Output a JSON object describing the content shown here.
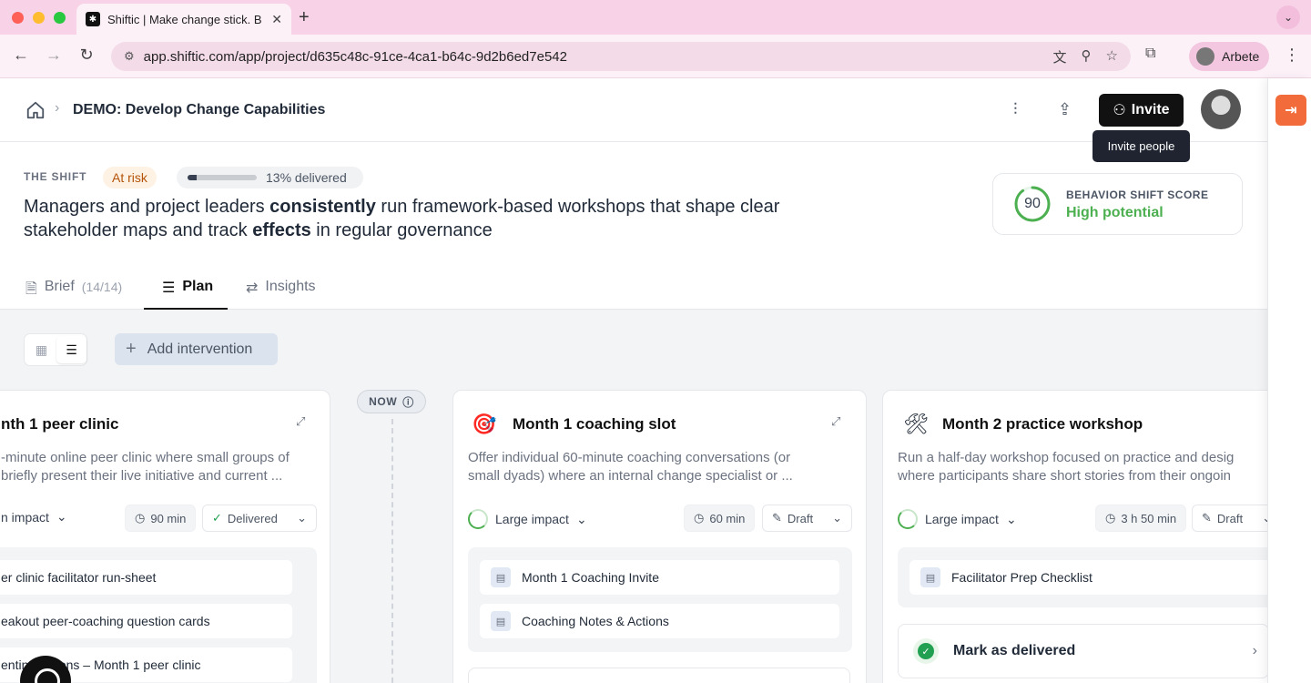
{
  "browser": {
    "tab_title": "Shiftic | Make change stick. B",
    "url": "app.shiftic.com/app/project/d635c48c-91ce-4ca1-b64c-9d2b6ed7e542",
    "profile_name": "Arbete"
  },
  "header": {
    "project_title": "DEMO: Develop Change Capabilities",
    "invite_label": "Invite",
    "tooltip": "Invite people"
  },
  "shift": {
    "label": "THE SHIFT",
    "status": "At risk",
    "progress_text": "13% delivered",
    "progress_fraction": 0.13,
    "statement_parts": [
      "Managers and project leaders ",
      "consistently",
      " run framework-based workshops that shape clear stakeholder maps and track ",
      "effects",
      " in regular governance"
    ]
  },
  "score": {
    "value": "90",
    "label": "BEHAVIOR SHIFT SCORE",
    "rating": "High potential",
    "fraction": 0.9
  },
  "tabs": [
    {
      "label": "Brief",
      "count": "(14/14)"
    },
    {
      "label": "Plan",
      "count": ""
    },
    {
      "label": "Insights",
      "count": ""
    }
  ],
  "plan": {
    "add_label": "Add intervention",
    "now_label": "NOW"
  },
  "cards": [
    {
      "title": "nth 1 peer clinic",
      "desc1": "-minute online peer clinic where small groups of",
      "desc2": "briefly present their live initiative and current ...",
      "impact": "n impact",
      "duration": "90 min",
      "status": "Delivered",
      "assets": [
        "er clinic facilitator run-sheet",
        "eakout peer-coaching question cards",
        "entin   uestions – Month 1 peer clinic"
      ]
    },
    {
      "title": "Month 1 coaching slot",
      "desc1": "Offer individual 60-minute coaching conversations (or",
      "desc2": "small dyads) where an internal change specialist or ...",
      "impact": "Large impact",
      "duration": "60 min",
      "status": "Draft",
      "assets": [
        "Month 1 Coaching Invite",
        "Coaching Notes & Actions"
      ]
    },
    {
      "title": "Month 2 practice workshop",
      "desc1": "Run a half-day workshop focused on practice and desig",
      "desc2": "where participants share short stories from their ongoin",
      "impact": "Large impact",
      "duration": "3 h 50 min",
      "status": "Draft",
      "assets": [
        "Facilitator Prep Checklist"
      ],
      "action": "Mark as delivered"
    }
  ],
  "icons": {
    "accent": "#4caf50",
    "brand_orange": "#f26b3a"
  }
}
